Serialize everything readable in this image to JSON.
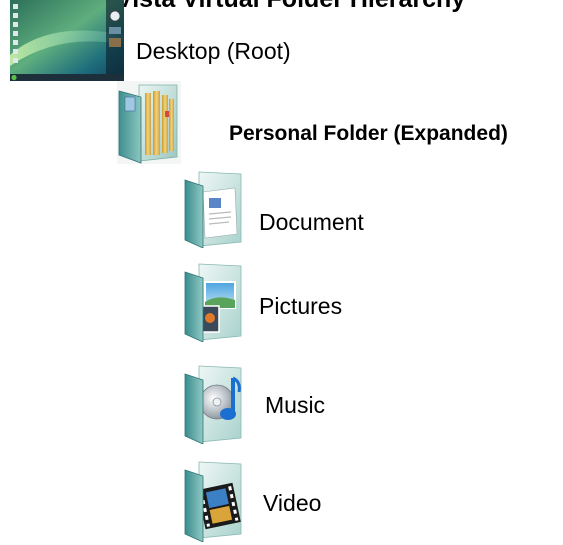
{
  "title": "Vista Virtual Folder Hierarchy",
  "nodes": {
    "root": {
      "label": "Desktop (Root)",
      "icon": "desktop-icon"
    },
    "personal": {
      "label": "Personal Folder  (Expanded)",
      "icon": "personal-folder-icon"
    },
    "documents": {
      "label": "Document",
      "icon": "documents-folder-icon"
    },
    "pictures": {
      "label": "Pictures",
      "icon": "pictures-folder-icon"
    },
    "music": {
      "label": "Music",
      "icon": "music-folder-icon"
    },
    "video": {
      "label": "Video",
      "icon": "video-folder-icon"
    }
  },
  "colors": {
    "folder_teal": "#4f9fa0",
    "folder_light": "#cfe9e6",
    "desktop_green": "#3f8f6a",
    "personal_gold": "#e2b64a"
  }
}
